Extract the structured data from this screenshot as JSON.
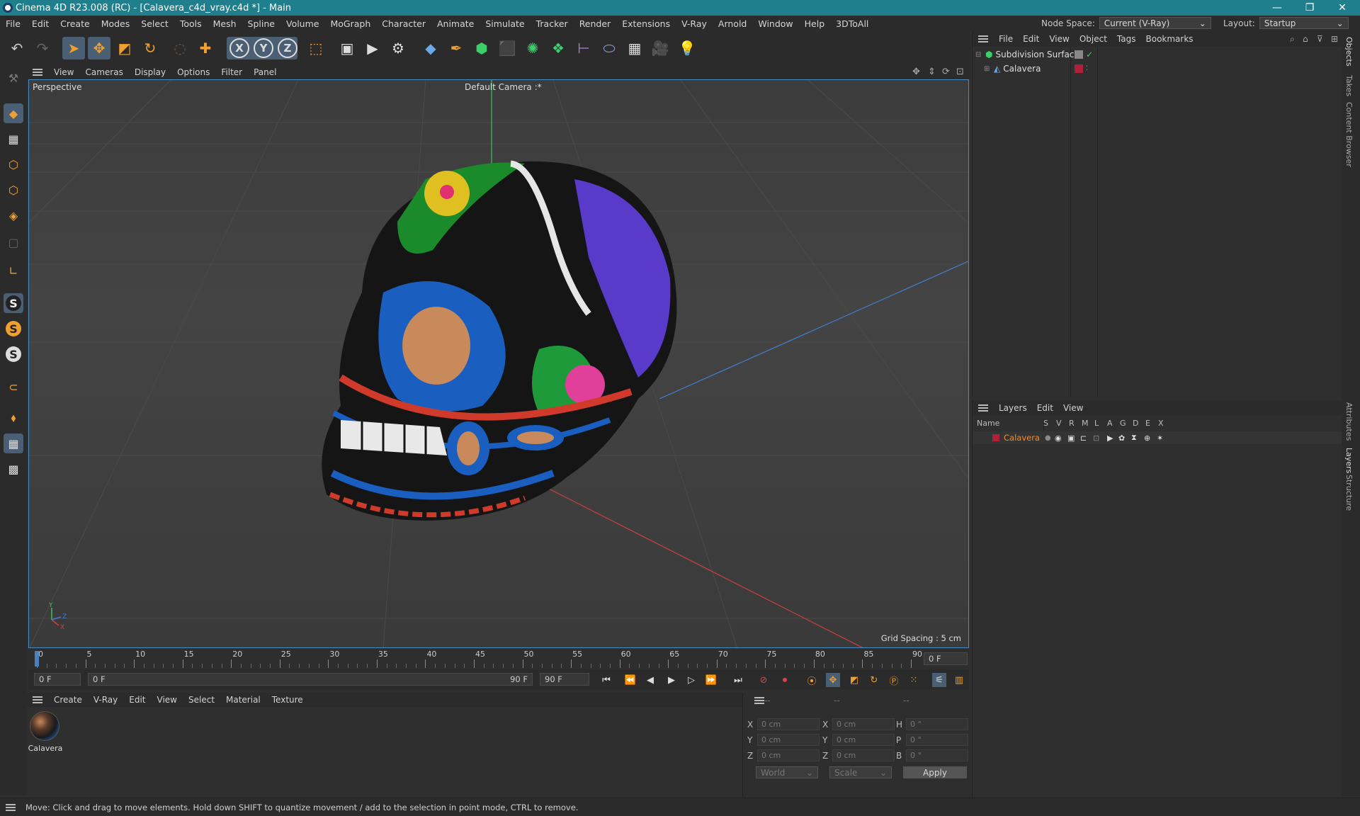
{
  "window": {
    "title": "Cinema 4D R23.008 (RC) - [Calavera_c4d_vray.c4d *] - Main",
    "minimize": "—",
    "maximize": "❐",
    "close": "✕"
  },
  "menu": [
    "File",
    "Edit",
    "Create",
    "Modes",
    "Select",
    "Tools",
    "Mesh",
    "Spline",
    "Volume",
    "MoGraph",
    "Character",
    "Animate",
    "Simulate",
    "Tracker",
    "Render",
    "Extensions",
    "V-Ray",
    "Arnold",
    "Window",
    "Help",
    "3DToAll"
  ],
  "node_space": {
    "label": "Node Space:",
    "value": "Current (V-Ray)"
  },
  "layout": {
    "label": "Layout:",
    "value": "Startup"
  },
  "viewport_menu": [
    "View",
    "Cameras",
    "Display",
    "Options",
    "Filter",
    "Panel"
  ],
  "viewport": {
    "name": "Perspective",
    "camera": "Default Camera :*",
    "grid_spacing": "Grid Spacing : 5 cm",
    "axis_y": "Y",
    "axis_z": "Z",
    "axis_x": "X"
  },
  "timeline": {
    "ticks": [
      "0",
      "5",
      "10",
      "15",
      "20",
      "25",
      "30",
      "35",
      "40",
      "45",
      "50",
      "55",
      "60",
      "65",
      "70",
      "75",
      "80",
      "85",
      "90"
    ],
    "current_frame_display": "0 F"
  },
  "transport": {
    "start": "0 F",
    "range_start": "0 F",
    "range_end": "90 F",
    "end": "90 F"
  },
  "material_menu": [
    "Create",
    "V-Ray",
    "Edit",
    "View",
    "Select",
    "Material",
    "Texture"
  ],
  "materials": [
    {
      "name": "Calavera"
    }
  ],
  "coords": {
    "headers": [
      "--",
      "--",
      "--"
    ],
    "rows": [
      {
        "l1": "X",
        "v1": "0 cm",
        "l2": "X",
        "v2": "0 cm",
        "l3": "H",
        "v3": "0 °"
      },
      {
        "l1": "Y",
        "v1": "0 cm",
        "l2": "Y",
        "v2": "0 cm",
        "l3": "P",
        "v3": "0 °"
      },
      {
        "l1": "Z",
        "v1": "0 cm",
        "l2": "Z",
        "v2": "0 cm",
        "l3": "B",
        "v3": "0 °"
      }
    ],
    "space": "World",
    "mode": "Scale",
    "apply": "Apply"
  },
  "object_menu": [
    "File",
    "Edit",
    "View",
    "Object",
    "Tags",
    "Bookmarks"
  ],
  "objects": [
    {
      "name": "Subdivision Surface"
    },
    {
      "name": "Calavera"
    }
  ],
  "layer_menu": [
    "Layers",
    "Edit",
    "View"
  ],
  "layer_columns": [
    "Name",
    "S",
    "V",
    "R",
    "M",
    "L",
    "A",
    "G",
    "D",
    "E",
    "X"
  ],
  "layers": [
    {
      "name": "Calavera",
      "color": "#b0203a"
    }
  ],
  "right_tabs": [
    "Objects",
    "Takes",
    "Content Browser",
    "Attributes",
    "Layers",
    "Structure"
  ],
  "status": "Move: Click and drag to move elements. Hold down SHIFT to quantize movement / add to the selection in point mode, CTRL to remove.",
  "colors": {
    "accent": "#1f7f8c",
    "selection": "#4a5f73",
    "x_axis": "#d04040",
    "y_axis": "#40c060",
    "z_axis": "#4080d0",
    "layer_name": "#e8903a"
  }
}
